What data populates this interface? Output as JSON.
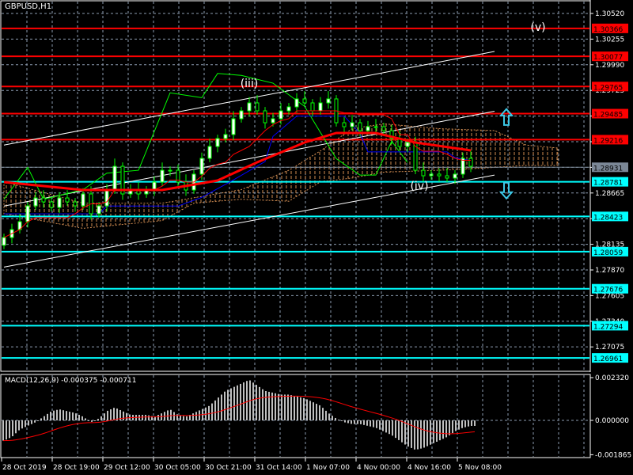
{
  "title": "GBPUSD,H1",
  "colors": {
    "bg": "#000000",
    "grid": "#8c9bb0",
    "resistance": "#ff0000",
    "support": "#00ffff",
    "current": "#7b8796",
    "candle_wick": "#00ff00",
    "candle_bull": "#ffffff",
    "ma": "#ff0000",
    "kijun": "#0000ff",
    "chikou": "#00ff00",
    "cloud": "#f4a460",
    "channel": "#ffffff",
    "macd_hist": "#c0c0c0",
    "macd_signal": "#ff0000"
  },
  "chart_data": [
    {
      "type": "candlestick",
      "name": "GBPUSD H1 price",
      "ylim": [
        1.2682,
        1.3065
      ],
      "y_ticks": [
        "1.30520",
        "1.30255",
        "1.29990",
        "1.29725",
        "1.29460",
        "1.29195",
        "1.28930",
        "1.28665",
        "1.28400",
        "1.28135",
        "1.27870",
        "1.27605",
        "1.27340",
        "1.27075"
      ],
      "x_ticks": [
        "28 Oct 2019",
        "28 Oct 19:00",
        "29 Oct 12:00",
        "30 Oct 05:00",
        "30 Oct 21:00",
        "31 Oct 14:00",
        "1 Nov 07:00",
        "4 Nov 00:00",
        "4 Nov 16:00",
        "5 Nov 08:00"
      ],
      "closes": [
        1.28205,
        1.28287,
        1.28369,
        1.28532,
        1.28614,
        1.28573,
        1.28516,
        1.28614,
        1.28573,
        1.28532,
        1.28655,
        1.28451,
        1.28532,
        1.28696,
        1.28941,
        1.28655,
        1.28696,
        1.28655,
        1.28696,
        1.28778,
        1.289,
        1.289,
        1.28778,
        1.28696,
        1.2886,
        1.29023,
        1.29146,
        1.29228,
        1.29269,
        1.29432,
        1.29514,
        1.29596,
        1.29514,
        1.29391,
        1.29432,
        1.29514,
        1.29555,
        1.29637,
        1.29596,
        1.29514,
        1.29596,
        1.29637,
        1.29391,
        1.2935,
        1.29391,
        1.29309,
        1.2935,
        1.2935,
        1.29309,
        1.29228,
        1.29146,
        1.29187,
        1.289,
        1.28843,
        1.2886,
        1.28843,
        1.28819,
        1.2886,
        1.29023,
        1.28941
      ],
      "moving_average": [
        [
          0,
          1.28778
        ],
        [
          10,
          1.28696
        ],
        [
          20,
          1.28696
        ],
        [
          27,
          1.28794
        ],
        [
          32,
          1.28982
        ],
        [
          38,
          1.29187
        ],
        [
          42,
          1.29285
        ],
        [
          47,
          1.29285
        ],
        [
          52,
          1.29187
        ],
        [
          59,
          1.29105
        ]
      ],
      "kijun": [
        [
          0,
          1.2845
        ],
        [
          12,
          1.2845
        ],
        [
          13,
          1.2853
        ],
        [
          22,
          1.2853
        ],
        [
          25,
          1.2862
        ],
        [
          29,
          1.288
        ],
        [
          33,
          1.2899
        ],
        [
          34,
          1.2925
        ],
        [
          37,
          1.2946
        ],
        [
          43,
          1.2946
        ],
        [
          45,
          1.2928
        ],
        [
          46,
          1.2909
        ],
        [
          56,
          1.2909
        ],
        [
          57,
          1.2903
        ],
        [
          59,
          1.29
        ]
      ],
      "chikou": [
        [
          0,
          1.286
        ],
        [
          3,
          1.2893
        ],
        [
          5,
          1.286
        ],
        [
          10,
          1.287
        ],
        [
          13,
          1.2887
        ],
        [
          17,
          1.289
        ],
        [
          21,
          1.297
        ],
        [
          25,
          1.2965
        ],
        [
          27,
          1.299
        ],
        [
          30,
          1.2988
        ],
        [
          34,
          1.298
        ],
        [
          38,
          1.2956
        ],
        [
          42,
          1.2902
        ],
        [
          45,
          1.2885
        ],
        [
          47,
          1.2885
        ],
        [
          49,
          1.292
        ],
        [
          51,
          1.2898
        ]
      ],
      "cloud_upper": [
        [
          0,
          1.2878
        ],
        [
          10,
          1.2856
        ],
        [
          20,
          1.2856
        ],
        [
          30,
          1.287
        ],
        [
          36,
          1.289
        ],
        [
          40,
          1.291
        ],
        [
          44,
          1.2933
        ],
        [
          48,
          1.2938
        ],
        [
          55,
          1.2933
        ],
        [
          62,
          1.2931
        ],
        [
          66,
          1.2916
        ],
        [
          70,
          1.2913
        ]
      ],
      "cloud_lower": [
        [
          0,
          1.2845
        ],
        [
          10,
          1.283
        ],
        [
          20,
          1.2838
        ],
        [
          24,
          1.2856
        ],
        [
          30,
          1.286
        ],
        [
          36,
          1.2858
        ],
        [
          40,
          1.2878
        ],
        [
          44,
          1.2882
        ],
        [
          48,
          1.2888
        ],
        [
          55,
          1.289
        ],
        [
          60,
          1.2892
        ],
        [
          66,
          1.2895
        ],
        [
          70,
          1.2895
        ]
      ],
      "levels": [
        {
          "price": 1.30366,
          "label": "1.30366",
          "kind": "resistance"
        },
        {
          "price": 1.30077,
          "label": "1.30077",
          "kind": "resistance"
        },
        {
          "price": 1.29765,
          "label": "1.29765",
          "kind": "resistance"
        },
        {
          "price": 1.29485,
          "label": "1.29485",
          "kind": "resistance"
        },
        {
          "price": 1.29216,
          "label": "1.29216",
          "kind": "resistance"
        },
        {
          "price": 1.28931,
          "label": "1.28931",
          "kind": "current"
        },
        {
          "price": 1.28781,
          "label": "1.28781",
          "kind": "support"
        },
        {
          "price": 1.28423,
          "label": "1.28423",
          "kind": "support"
        },
        {
          "price": 1.28059,
          "label": "1.28059",
          "kind": "support"
        },
        {
          "price": 1.27676,
          "label": "1.27676",
          "kind": "support"
        },
        {
          "price": 1.27294,
          "label": "1.27294",
          "kind": "support"
        },
        {
          "price": 1.26961,
          "label": "1.26961",
          "kind": "support"
        }
      ],
      "channel": [
        {
          "name": "upper",
          "from": [
            0,
            1.2916
          ],
          "to": [
            62,
            1.30127
          ]
        },
        {
          "name": "middle",
          "from": [
            0,
            1.2853
          ],
          "to": [
            62,
            1.2951
          ]
        },
        {
          "name": "lower",
          "from": [
            0,
            1.279
          ],
          "to": [
            62,
            1.2885
          ]
        }
      ],
      "annotations": [
        {
          "text": "(iii)",
          "bar": 31,
          "price": 1.2976
        },
        {
          "text": "(iv)",
          "bar": 52.5,
          "price": 1.287
        },
        {
          "text": "(v)",
          "bar": 67.5,
          "price": 1.3034
        }
      ],
      "arrows": [
        {
          "direction": "up",
          "bar": 63.5,
          "price": 1.2945
        },
        {
          "direction": "down",
          "bar": 63.5,
          "price": 1.2869
        }
      ]
    },
    {
      "type": "bar",
      "name": "MACD",
      "label": "MACD(12,26,9) -0.000375 -0.000711",
      "ylim": [
        -0.001865,
        0.00232
      ],
      "y_ticks": [
        "0.002320",
        "0.000000",
        "-0.001865"
      ],
      "histogram": [
        -0.0011,
        -0.0009,
        -0.0005,
        -0.0003,
        -0.0001,
        0.0002,
        0.0005,
        0.0006,
        0.0005,
        0.0004,
        0.0002,
        -0.0001,
        0.0001,
        0.0005,
        0.0007,
        0.0005,
        0.0003,
        0.0003,
        0.0003,
        0.0002,
        0.0004,
        0.0006,
        0.0003,
        0.0002,
        0.0004,
        0.0006,
        0.0008,
        0.0012,
        0.0016,
        0.0018,
        0.002,
        0.0022,
        0.0019,
        0.0016,
        0.0015,
        0.0014,
        0.0014,
        0.0013,
        0.0012,
        0.001,
        0.0008,
        0.0004,
        0.0001,
        -0.0001,
        -0.0002,
        -0.0002,
        -0.0003,
        -0.0004,
        -0.0006,
        -0.0008,
        -0.0011,
        -0.0014,
        -0.0016,
        -0.0015,
        -0.0013,
        -0.0011,
        -0.0009,
        -0.0006,
        -0.0004,
        -0.0003
      ]
    }
  ]
}
